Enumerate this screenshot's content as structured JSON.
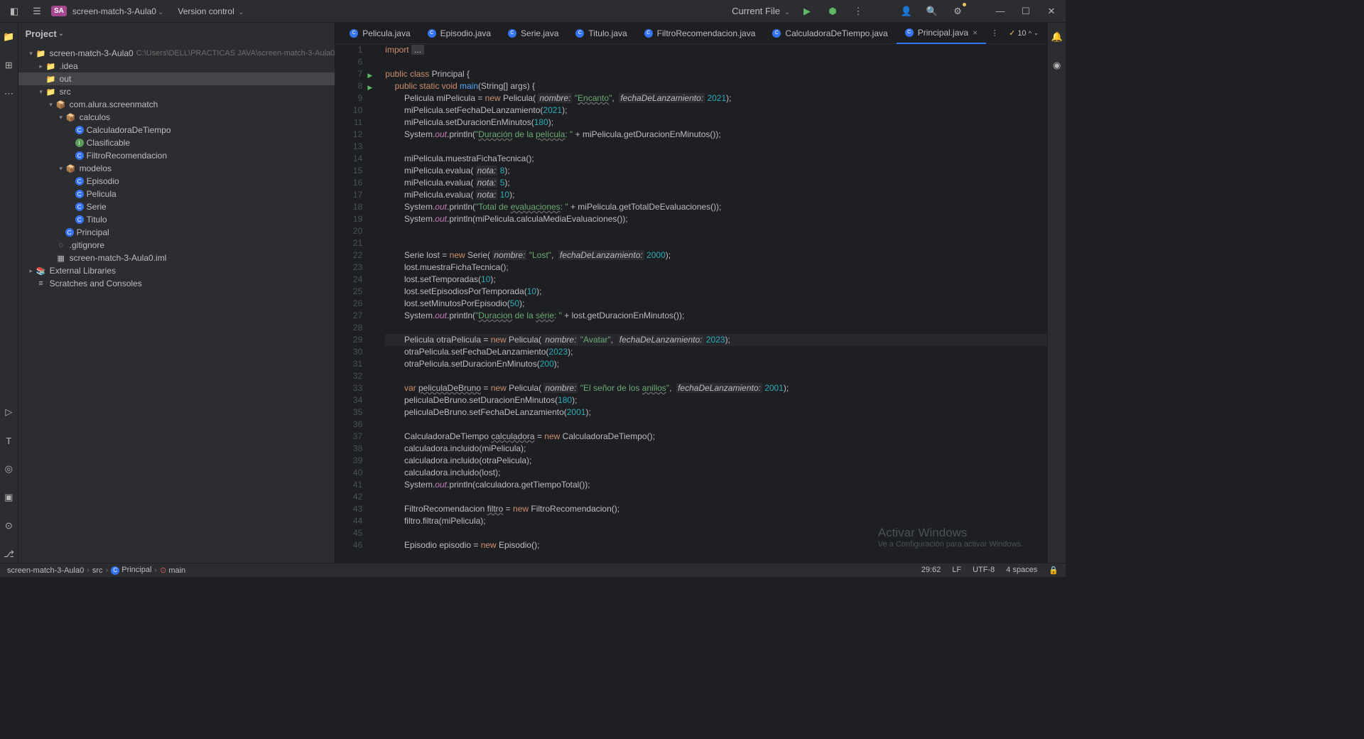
{
  "topbar": {
    "project_badge": "SA",
    "project_name": "screen-match-3-Aula0",
    "version_control": "Version control",
    "current_file": "Current File"
  },
  "sidebar": {
    "title": "Project",
    "tree": [
      {
        "level": 0,
        "chev": "▾",
        "icon": "folder",
        "label": "screen-match-3-Aula0",
        "path": "C:\\Users\\DELL\\PRACTICAS JAVA\\screen-match-3-Aula0"
      },
      {
        "level": 1,
        "chev": "▸",
        "icon": "folder",
        "label": ".idea"
      },
      {
        "level": 1,
        "chev": "",
        "icon": "folder-out",
        "label": "out",
        "selected": true
      },
      {
        "level": 1,
        "chev": "▾",
        "icon": "folder-src",
        "label": "src"
      },
      {
        "level": 2,
        "chev": "▾",
        "icon": "pkg",
        "label": "com.alura.screenmatch"
      },
      {
        "level": 3,
        "chev": "▾",
        "icon": "pkg",
        "label": "calculos"
      },
      {
        "level": 4,
        "chev": "",
        "icon": "class",
        "label": "CalculadoraDeTiempo"
      },
      {
        "level": 4,
        "chev": "",
        "icon": "interface",
        "label": "Clasificable"
      },
      {
        "level": 4,
        "chev": "",
        "icon": "class",
        "label": "FiltroRecomendacion"
      },
      {
        "level": 3,
        "chev": "▾",
        "icon": "pkg",
        "label": "modelos"
      },
      {
        "level": 4,
        "chev": "",
        "icon": "class",
        "label": "Episodio"
      },
      {
        "level": 4,
        "chev": "",
        "icon": "class",
        "label": "Pelicula"
      },
      {
        "level": 4,
        "chev": "",
        "icon": "class",
        "label": "Serie"
      },
      {
        "level": 4,
        "chev": "",
        "icon": "class",
        "label": "Titulo"
      },
      {
        "level": 3,
        "chev": "",
        "icon": "class",
        "label": "Principal"
      },
      {
        "level": 2,
        "chev": "",
        "icon": "gitignore",
        "label": ".gitignore"
      },
      {
        "level": 2,
        "chev": "",
        "icon": "iml",
        "label": "screen-match-3-Aula0.iml"
      },
      {
        "level": 0,
        "chev": "▸",
        "icon": "lib",
        "label": "External Libraries"
      },
      {
        "level": 0,
        "chev": "",
        "icon": "scratch",
        "label": "Scratches and Consoles"
      }
    ]
  },
  "tabs": {
    "items": [
      {
        "label": "Pelicula.java"
      },
      {
        "label": "Episodio.java"
      },
      {
        "label": "Serie.java"
      },
      {
        "label": "Titulo.java"
      },
      {
        "label": "FiltroRecomendacion.java"
      },
      {
        "label": "CalculadoraDeTiempo.java"
      },
      {
        "label": "Principal.java",
        "active": true,
        "closable": true
      }
    ],
    "inspection_count": "10"
  },
  "code": {
    "lines": [
      {
        "n": 1,
        "html": "<span class='kw'>import</span> <span style='background:#393b40;padding:0 4px;'>...</span>"
      },
      {
        "n": 6,
        "html": ""
      },
      {
        "n": 7,
        "run": true,
        "html": "<span class='kw'>public class</span> <span class='type'>Principal</span> {"
      },
      {
        "n": 8,
        "run": true,
        "html": "    <span class='kw'>public static void</span> <span class='fn'>main</span>(String[] args) {"
      },
      {
        "n": 9,
        "html": "        Pelicula miPelicula = <span class='kw'>new</span> Pelicula( <span class='param'>nombre:</span> <span class='str'>\"<span class='under'>Encanto</span>\"</span>,  <span class='param'>fechaDeLanzamiento:</span> <span class='num'>2021</span>);"
      },
      {
        "n": 10,
        "html": "        miPelicula.setFechaDeLanzamiento(<span class='num'>2021</span>);"
      },
      {
        "n": 11,
        "html": "        miPelicula.setDuracionEnMinutos(<span class='num'>180</span>);"
      },
      {
        "n": 12,
        "html": "        System.<span class='field'>out</span>.println(<span class='str'>\"<span class='under'>Duración</span> de la <span class='under'>película</span>: \"</span> + miPelicula.getDuracionEnMinutos());"
      },
      {
        "n": 13,
        "html": ""
      },
      {
        "n": 14,
        "html": "        miPelicula.muestraFichaTecnica();"
      },
      {
        "n": 15,
        "html": "        miPelicula.evalua( <span class='param'>nota:</span> <span class='num'>8</span>);"
      },
      {
        "n": 16,
        "html": "        miPelicula.evalua( <span class='param'>nota:</span> <span class='num'>5</span>);"
      },
      {
        "n": 17,
        "html": "        miPelicula.evalua( <span class='param'>nota:</span> <span class='num'>10</span>);"
      },
      {
        "n": 18,
        "html": "        System.<span class='field'>out</span>.println(<span class='str'>\"Total de <span class='under'>evaluaciones</span>: \"</span> + miPelicula.getTotalDeEvaluaciones());"
      },
      {
        "n": 19,
        "html": "        System.<span class='field'>out</span>.println(miPelicula.calculaMediaEvaluaciones());"
      },
      {
        "n": 20,
        "html": ""
      },
      {
        "n": 21,
        "html": ""
      },
      {
        "n": 22,
        "html": "        Serie lost = <span class='kw'>new</span> Serie( <span class='param'>nombre:</span> <span class='str'>\"Lost\"</span>,  <span class='param'>fechaDeLanzamiento:</span> <span class='num'>2000</span>);"
      },
      {
        "n": 23,
        "html": "        lost.muestraFichaTecnica();"
      },
      {
        "n": 24,
        "html": "        lost.setTemporadas(<span class='num'>10</span>);"
      },
      {
        "n": 25,
        "html": "        lost.setEpisodiosPorTemporada(<span class='num'>10</span>);"
      },
      {
        "n": 26,
        "html": "        lost.setMinutosPorEpisodio(<span class='num'>50</span>);"
      },
      {
        "n": 27,
        "html": "        System.<span class='field'>out</span>.println(<span class='str'>\"<span class='under'>Duracion</span> de la <span class='under'>série</span>: \"</span> + lost.getDuracionEnMinutos());"
      },
      {
        "n": 28,
        "html": ""
      },
      {
        "n": 29,
        "current": true,
        "html": "        Pelicula otraPelicula = <span class='kw'>new</span> Pelicula( <span class='param'>nombre:</span> <span class='str'>\"Avatar\"</span>,  <span class='param'>fechaDeLanzamiento:</span> <span class='num'>2023</span>);"
      },
      {
        "n": 30,
        "html": "        otraPelicula.setFechaDeLanzamiento(<span class='num'>2023</span>);"
      },
      {
        "n": 31,
        "html": "        otraPelicula.setDuracionEnMinutos(<span class='num'>200</span>);"
      },
      {
        "n": 32,
        "html": ""
      },
      {
        "n": 33,
        "html": "        <span class='kw'>var</span> <span class='under'>peliculaDeBruno</span> = <span class='kw'>new</span> Pelicula( <span class='param'>nombre:</span> <span class='str'>\"El señor de los <span class='under'>anillos</span>\"</span>,  <span class='param'>fechaDeLanzamiento:</span> <span class='num'>2001</span>);"
      },
      {
        "n": 34,
        "html": "        peliculaDeBruno.setDuracionEnMinutos(<span class='num'>180</span>);"
      },
      {
        "n": 35,
        "html": "        peliculaDeBruno.setFechaDeLanzamiento(<span class='num'>2001</span>);"
      },
      {
        "n": 36,
        "html": ""
      },
      {
        "n": 37,
        "html": "        CalculadoraDeTiempo <span class='under'>calculadora</span> = <span class='kw'>new</span> CalculadoraDeTiempo();"
      },
      {
        "n": 38,
        "html": "        calculadora.incluido(miPelicula);"
      },
      {
        "n": 39,
        "html": "        calculadora.incluido(otraPelicula);"
      },
      {
        "n": 40,
        "html": "        calculadora.incluido(lost);"
      },
      {
        "n": 41,
        "html": "        System.<span class='field'>out</span>.println(calculadora.getTiempoTotal());"
      },
      {
        "n": 42,
        "html": ""
      },
      {
        "n": 43,
        "html": "        FiltroRecomendacion <span class='under'>filtro</span> = <span class='kw'>new</span> FiltroRecomendacion();"
      },
      {
        "n": 44,
        "html": "        filtro.filtra(miPelicula);"
      },
      {
        "n": 45,
        "html": ""
      },
      {
        "n": 46,
        "html": "        Episodio episodio = <span class='kw'>new</span> Episodio();"
      }
    ]
  },
  "breadcrumb": {
    "items": [
      "screen-match-3-Aula0",
      "src",
      "Principal",
      "main"
    ]
  },
  "status": {
    "pos": "29:62",
    "line_sep": "LF",
    "encoding": "UTF-8",
    "indent": "4 spaces"
  },
  "watermark": {
    "title": "Activar Windows",
    "sub": "Ve a Configuración para activar Windows."
  }
}
